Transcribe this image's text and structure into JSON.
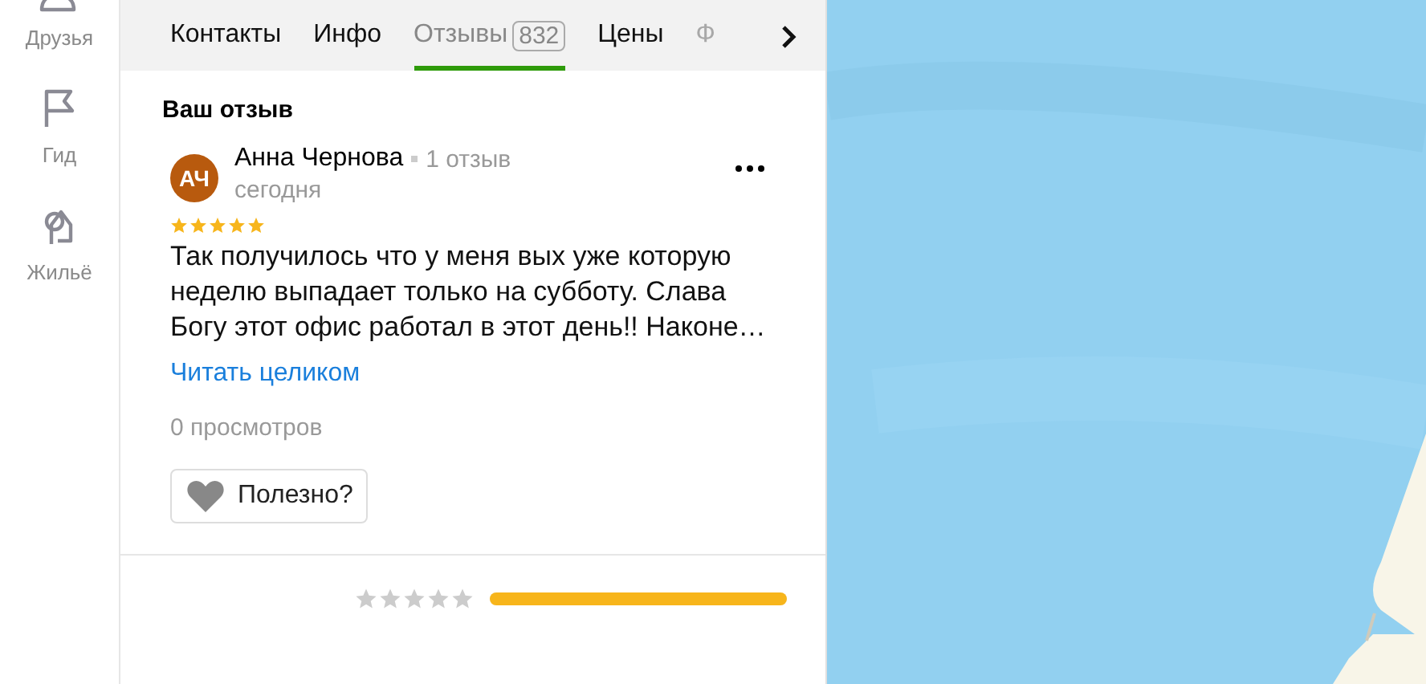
{
  "sidebar": {
    "items": [
      {
        "label": "Друзья",
        "kind": "friends"
      },
      {
        "label": "Гид",
        "kind": "guide"
      },
      {
        "label": "Жильё",
        "kind": "housing"
      }
    ]
  },
  "tabs": [
    {
      "label": "Контакты",
      "selected": false
    },
    {
      "label": "Инфо",
      "selected": false
    },
    {
      "label": "Отзывы",
      "count": "832",
      "selected": true
    },
    {
      "label": "Цены",
      "selected": false
    },
    {
      "label": "Ф",
      "selected": false,
      "faded": true
    }
  ],
  "section_title": "Ваш отзыв",
  "review": {
    "initials": "АЧ",
    "author": "Анна Чернова",
    "author_reviews": "1 отзыв",
    "date": "сегодня",
    "stars": 5,
    "text": "Так получилось что у меня вых уже которую неделю выпадает только на субботу. Слава Богу этот офис работал в этот день!! Наконе…",
    "read_more": "Читать целиком",
    "views": "0 просмотров",
    "helpful_button": "Полезно?"
  },
  "rating_row": {
    "stars": 0,
    "level": 1
  }
}
